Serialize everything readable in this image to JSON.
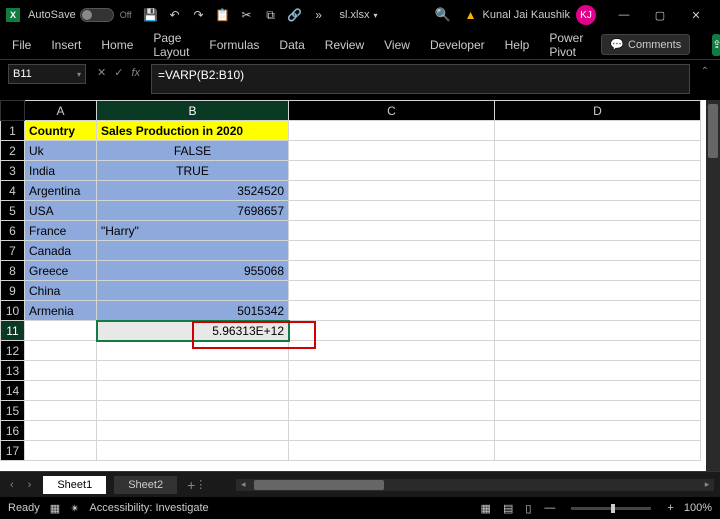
{
  "titlebar": {
    "autosave_label": "AutoSave",
    "autosave_state": "Off",
    "filename": "sl.xlsx",
    "user_name": "Kunal Jai Kaushik",
    "user_initials": "KJ"
  },
  "ribbon": {
    "tabs": [
      "File",
      "Insert",
      "Home",
      "Page Layout",
      "Formulas",
      "Data",
      "Review",
      "View",
      "Developer",
      "Help",
      "Power Pivot"
    ],
    "comments_label": "Comments"
  },
  "formula_bar": {
    "name_box": "B11",
    "formula": "=VARP(B2:B10)"
  },
  "grid": {
    "columns": [
      "A",
      "B",
      "C",
      "D"
    ],
    "header_row": {
      "A": "Country",
      "B": "Sales Production in 2020"
    },
    "rows": [
      {
        "A": "Uk",
        "B": "FALSE",
        "B_align": "center"
      },
      {
        "A": "India",
        "B": "TRUE",
        "B_align": "center"
      },
      {
        "A": "Argentina",
        "B": "3524520",
        "B_align": "right"
      },
      {
        "A": "USA",
        "B": "7698657",
        "B_align": "right"
      },
      {
        "A": "France",
        "B": "\"Harry\"",
        "B_align": "left"
      },
      {
        "A": "Canada",
        "B": "",
        "B_align": "left"
      },
      {
        "A": "Greece",
        "B": "955068",
        "B_align": "right"
      },
      {
        "A": "China",
        "B": "",
        "B_align": "left"
      },
      {
        "A": "Armenia",
        "B": "5015342",
        "B_align": "right"
      }
    ],
    "result_cell": "5.96313E+12",
    "extra_rows": [
      "12",
      "13",
      "14",
      "15",
      "16",
      "17"
    ]
  },
  "sheet_bar": {
    "tabs": [
      "Sheet1",
      "Sheet2"
    ],
    "active": 0
  },
  "status_bar": {
    "ready": "Ready",
    "accessibility": "Accessibility: Investigate",
    "zoom": "100%"
  }
}
